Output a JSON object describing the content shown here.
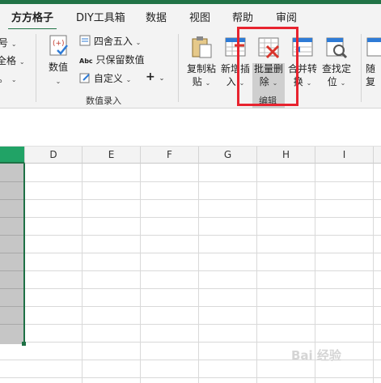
{
  "tabs": [
    {
      "label": "方方格子"
    },
    {
      "label": "DIY工具箱"
    },
    {
      "label": "数据"
    },
    {
      "label": "视图"
    },
    {
      "label": "帮助"
    },
    {
      "label": "审阅"
    }
  ],
  "ribbon": {
    "left_partial": [
      "号",
      "全格",
      "。"
    ],
    "numeric_group": {
      "value_button": "数值",
      "round_label": "四舍五入",
      "keep_value_label": "只保留数值",
      "custom_label": "自定义",
      "plus_label": "+",
      "group_label": "数值录入"
    },
    "edit_group": {
      "copy_paste": [
        "复制粘",
        "贴"
      ],
      "new_insert": [
        "新增插",
        "入"
      ],
      "batch_delete": [
        "批量删",
        "除"
      ],
      "merge_convert": [
        "合并转",
        "换"
      ],
      "find_locate": [
        "查找定",
        "位"
      ],
      "group_label": "编辑"
    },
    "random_partial": [
      "随",
      "复"
    ]
  },
  "columns": [
    "D",
    "E",
    "F",
    "G",
    "H",
    "I"
  ],
  "watermark": "Bai 经验",
  "colors": {
    "accent": "#217346",
    "highlight": "#e8232f"
  }
}
